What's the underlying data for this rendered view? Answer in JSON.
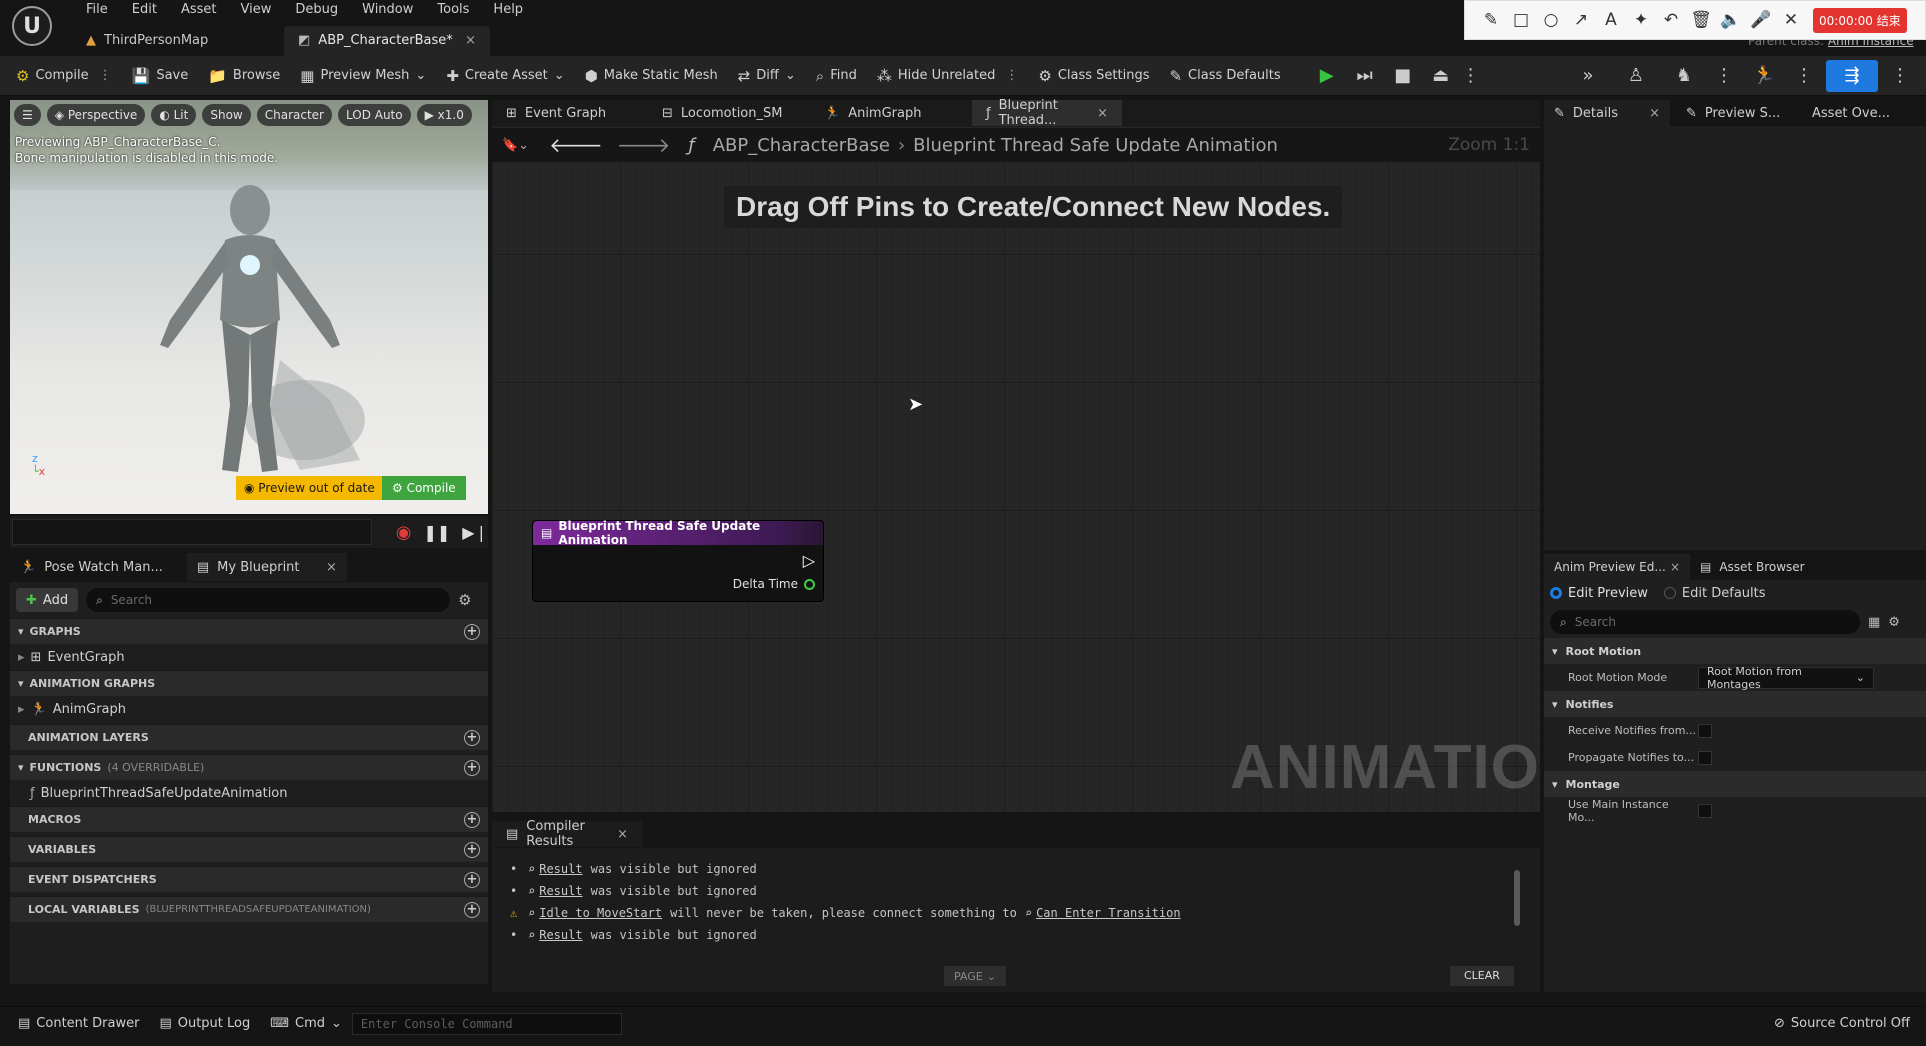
{
  "app": {
    "menu": [
      "File",
      "Edit",
      "Asset",
      "View",
      "Debug",
      "Window",
      "Tools",
      "Help"
    ],
    "doc_tabs": [
      {
        "label": "ThirdPersonMap",
        "active": false
      },
      {
        "label": "ABP_CharacterBase*",
        "active": true
      }
    ],
    "parent_class_label": "Parent class:",
    "parent_class_value": "Anim Instance",
    "recorder_timer": "00:00:00 结束"
  },
  "toolbar": {
    "compile": "Compile",
    "save": "Save",
    "browse": "Browse",
    "preview_mesh": "Preview Mesh",
    "create_asset": "Create Asset",
    "make_static_mesh": "Make Static Mesh",
    "diff": "Diff",
    "find": "Find",
    "hide_unrelated": "Hide Unrelated",
    "class_settings": "Class Settings",
    "class_defaults": "Class Defaults"
  },
  "viewport": {
    "perspective": "Perspective",
    "lit": "Lit",
    "show": "Show",
    "character": "Character",
    "lod": "LOD Auto",
    "speed": "x1.0",
    "note_line1": "Previewing ABP_CharacterBase_C.",
    "note_line2": "Bone manipulation is disabled in this mode.",
    "preview_out_of_date": "Preview out of date",
    "compile_button": "Compile"
  },
  "left_panel": {
    "tabs": [
      "Pose Watch Man...",
      "My Blueprint"
    ],
    "add_label": "Add",
    "search_placeholder": "Search",
    "graphs_header": "GRAPHS",
    "graphs_item": "EventGraph",
    "anim_graphs_header": "ANIMATION GRAPHS",
    "anim_graphs_item": "AnimGraph",
    "anim_layers_header": "ANIMATION LAYERS",
    "functions_header": "FUNCTIONS",
    "functions_overridable": "(4 OVERRIDABLE)",
    "function_item": "BlueprintThreadSafeUpdateAnimation",
    "macros_header": "MACROS",
    "variables_header": "VARIABLES",
    "event_dispatchers_header": "EVENT DISPATCHERS",
    "local_variables_header": "LOCAL VARIABLES",
    "local_variables_scope": "(BLUEPRINTTHREADSAFEUPDATEANIMATION)"
  },
  "graph": {
    "tabs": [
      "Event Graph",
      "Locomotion_SM",
      "AnimGraph",
      "Blueprint Thread..."
    ],
    "breadcrumb_root": "ABP_CharacterBase",
    "breadcrumb_current": "Blueprint Thread Safe Update Animation",
    "zoom": "Zoom 1:1",
    "hint": "Drag Off Pins to Create/Connect New Nodes.",
    "watermark": "ANIMATION",
    "node_title": "Blueprint Thread Safe Update Animation",
    "node_pin": "Delta Time"
  },
  "compiler": {
    "tab": "Compiler Results",
    "lines": [
      {
        "link": "Result",
        "text": "was visible but ignored",
        "warn": false
      },
      {
        "link": "Result",
        "text": "was visible but ignored",
        "warn": false
      },
      {
        "link": "Idle to MoveStart",
        "text": "will never be taken, please connect something to",
        "link2": "Can Enter Transition",
        "warn": true
      },
      {
        "link": "Result",
        "text": "was visible but ignored",
        "warn": false
      }
    ],
    "page": "PAGE",
    "clear": "CLEAR"
  },
  "right_panel": {
    "tabs": [
      "Details",
      "Preview S...",
      "Asset Ove..."
    ],
    "bottom_tabs": [
      "Anim Preview Ed...",
      "Asset Browser"
    ],
    "edit_preview": "Edit Preview",
    "edit_defaults": "Edit Defaults",
    "search_placeholder": "Search",
    "root_motion_header": "Root Motion",
    "root_motion_mode_label": "Root Motion Mode",
    "root_motion_mode_value": "Root Motion from Montages",
    "notifies_header": "Notifies",
    "receive_notifies": "Receive Notifies from...",
    "propagate_notifies": "Propagate Notifies to...",
    "montage_header": "Montage",
    "use_main_instance": "Use Main Instance Mo..."
  },
  "status": {
    "content_drawer": "Content Drawer",
    "output_log": "Output Log",
    "cmd": "Cmd",
    "console_placeholder": "Enter Console Command",
    "source_control": "Source Control Off"
  }
}
